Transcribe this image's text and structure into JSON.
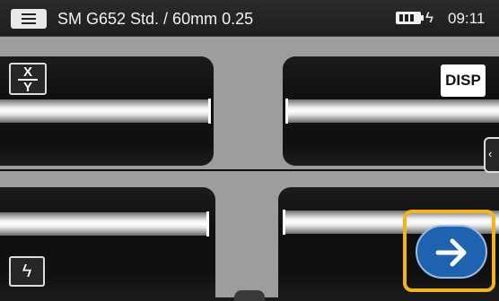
{
  "header": {
    "menu_icon": "hamburger-icon",
    "title": "SM G652 Std. / 60mm 0.25",
    "battery_icon": "battery-full-icon",
    "charging_icon": "lightning-icon",
    "charging_glyph": "ϟ",
    "time": "09:11"
  },
  "controls": {
    "xy_top": "X",
    "xy_bottom": "Y",
    "disp_label": "DISP",
    "side_tab_glyph": "‹",
    "arc_glyph": "ϟ",
    "next_icon": "arrow-right-icon"
  },
  "colors": {
    "next_button": "#1e63b0",
    "highlight": "#f5b414"
  }
}
